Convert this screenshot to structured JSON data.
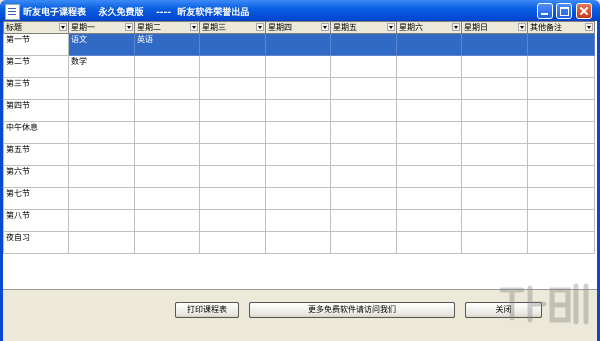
{
  "window": {
    "title": "昕友电子课程表    永久免费版    ----  昕友软件荣誉出品"
  },
  "grid": {
    "headers": [
      "标题",
      "星期一",
      "星期二",
      "星期三",
      "星期四",
      "星期五",
      "星期六",
      "星期日",
      "其他备注"
    ],
    "rows": [
      {
        "label": "第一节",
        "cells": [
          "语文",
          "英语",
          "",
          "",
          "",
          "",
          "",
          ""
        ],
        "selected": true
      },
      {
        "label": "第二节",
        "cells": [
          "数学",
          "",
          "",
          "",
          "",
          "",
          "",
          ""
        ]
      },
      {
        "label": "第三节",
        "cells": [
          "",
          "",
          "",
          "",
          "",
          "",
          "",
          ""
        ]
      },
      {
        "label": "第四节",
        "cells": [
          "",
          "",
          "",
          "",
          "",
          "",
          "",
          ""
        ]
      },
      {
        "label": "中午休息",
        "cells": [
          "",
          "",
          "",
          "",
          "",
          "",
          "",
          ""
        ]
      },
      {
        "label": "第五节",
        "cells": [
          "",
          "",
          "",
          "",
          "",
          "",
          "",
          ""
        ]
      },
      {
        "label": "第六节",
        "cells": [
          "",
          "",
          "",
          "",
          "",
          "",
          "",
          ""
        ]
      },
      {
        "label": "第七节",
        "cells": [
          "",
          "",
          "",
          "",
          "",
          "",
          "",
          ""
        ]
      },
      {
        "label": "第八节",
        "cells": [
          "",
          "",
          "",
          "",
          "",
          "",
          "",
          ""
        ]
      },
      {
        "label": "夜自习",
        "cells": [
          "",
          "",
          "",
          "",
          "",
          "",
          "",
          ""
        ]
      }
    ]
  },
  "buttons": {
    "print": "打印课程表",
    "more": "更多免费软件请访问我们",
    "close": "关闭"
  },
  "colors": {
    "titlebar": "#0a5fe0",
    "selection": "#316ac5",
    "face": "#ece9d8"
  },
  "icons": {
    "app": "app-icon",
    "minimize": "minimize-icon",
    "maximize": "maximize-icon",
    "close": "close-icon",
    "dropdown": "chevron-down-icon"
  }
}
